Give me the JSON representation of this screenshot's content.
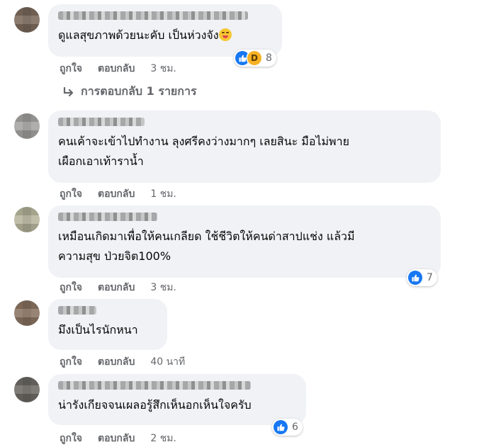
{
  "comments": [
    {
      "text": "ดูแลสุขภาพด้วยนะคับ เป็นห่วงจัง",
      "emoji": "smirk-tongue-emoji",
      "like_label": "ถูกใจ",
      "reply_label": "ตอบกลับ",
      "time": "3 ชม.",
      "reaction_count": "8",
      "reaction_icons": [
        "like-icon",
        "haha-icon"
      ],
      "colors": {
        "avatar": "#7c6a5c"
      }
    },
    {
      "text": "คนเค้าจะเข้าไปทำงาน ลุงศรีคงว่างมากๆ เลยสินะ มือไม่พาย\nเผือกเอาเท้าราน้ำ",
      "like_label": "ถูกใจ",
      "reply_label": "ตอบกลับ",
      "time": "1 ชม.",
      "colors": {
        "avatar": "#a5a3a0"
      }
    },
    {
      "text": "เหมือนเกิดมาเพื่อให้คนเกลียด ใช้ชีวิตให้คนด่าสาปแช่ง แล้วมี\nความสุข ป่วยจิต100%",
      "like_label": "ถูกใจ",
      "reply_label": "ตอบกลับ",
      "time": "3 ชม.",
      "reaction_count": "7",
      "reaction_icons": [
        "like-icon"
      ],
      "colors": {
        "avatar": "#b7b59c"
      }
    },
    {
      "text": "มึงเป็นไรนักหนา",
      "like_label": "ถูกใจ",
      "reply_label": "ตอบกลับ",
      "time": "40 นาที",
      "colors": {
        "avatar": "#8a7361"
      }
    },
    {
      "text": "น่ารังเกียจจนเผลอรู้สึกเห็นอกเห็นใจครับ",
      "like_label": "ถูกใจ",
      "reply_label": "ตอบกลับ",
      "time": "2 ชม.",
      "reaction_count": "6",
      "reaction_icons": [
        "like-icon"
      ],
      "colors": {
        "avatar": "#6d6a64"
      }
    }
  ],
  "view_replies": {
    "label": "การตอบกลับ 1 รายการ",
    "icon": "reply-arrow-icon"
  },
  "colors": {
    "bubble_bg": "#f0f2f5",
    "like_blue": "#1877f2",
    "haha_yellow": "#f7b125",
    "meta_gray": "#65676b"
  }
}
